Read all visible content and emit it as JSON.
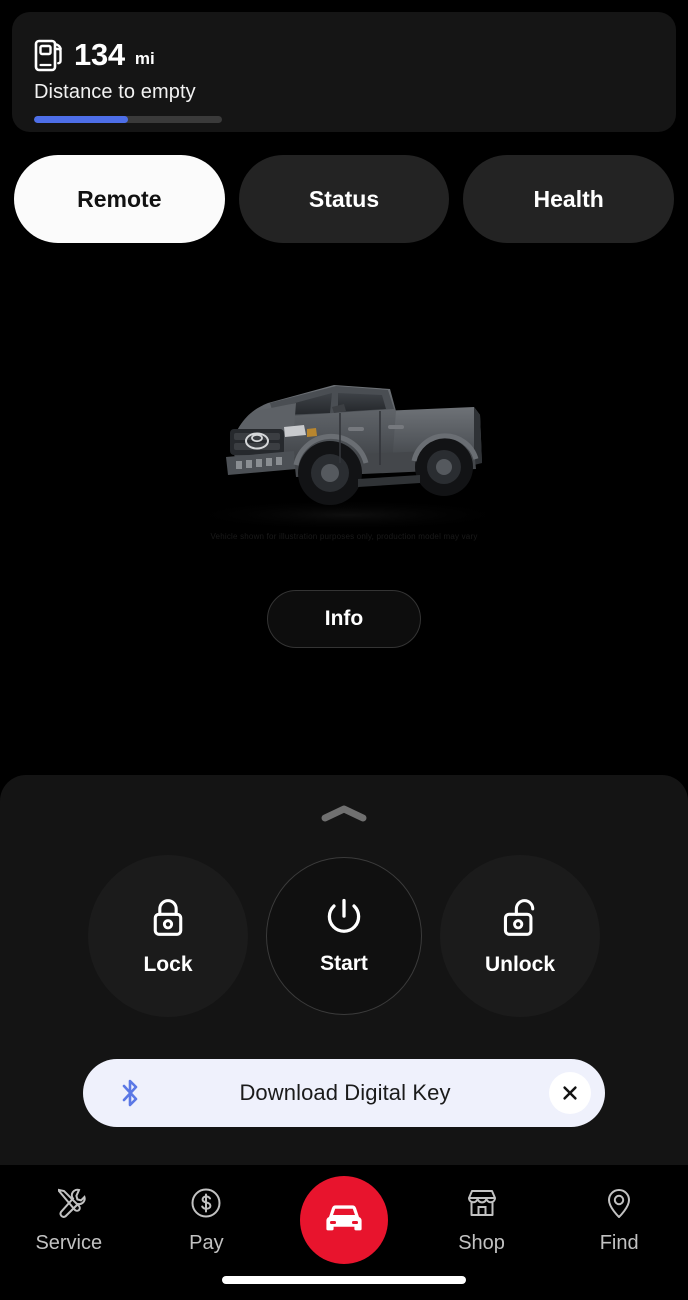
{
  "range_card": {
    "icon": "fuel-pump-icon",
    "value": "134",
    "unit": "mi",
    "label": "Distance to empty",
    "fill_percent": 50,
    "fill_color": "#4d6ee8",
    "track_color": "#3a3a3a"
  },
  "tabs": [
    {
      "label": "Remote",
      "active": true
    },
    {
      "label": "Status",
      "active": false
    },
    {
      "label": "Health",
      "active": false
    }
  ],
  "hero": {
    "vehicle": "toyota-tacoma-pickup",
    "caption": "Vehicle shown for illustration purposes only, production model may vary",
    "info_label": "Info"
  },
  "sheet": {
    "handle_icon": "chevron-up-icon",
    "actions": [
      {
        "label": "Lock",
        "icon": "lock-closed-icon"
      },
      {
        "label": "Start",
        "icon": "power-icon"
      },
      {
        "label": "Unlock",
        "icon": "lock-open-icon"
      }
    ]
  },
  "key_banner": {
    "icon": "bluetooth-icon",
    "text": "Download Digital Key",
    "close_icon": "close-icon",
    "background": "#eff1fc",
    "icon_color": "#5b78e5"
  },
  "nav": {
    "items": [
      {
        "label": "Service",
        "icon": "wrench-screwdriver-icon"
      },
      {
        "label": "Pay",
        "icon": "dollar-circle-icon"
      },
      {
        "label": "Shop",
        "icon": "storefront-icon"
      },
      {
        "label": "Find",
        "icon": "map-pin-icon"
      }
    ],
    "center": {
      "icon": "car-front-icon",
      "color": "#e8142d"
    }
  }
}
